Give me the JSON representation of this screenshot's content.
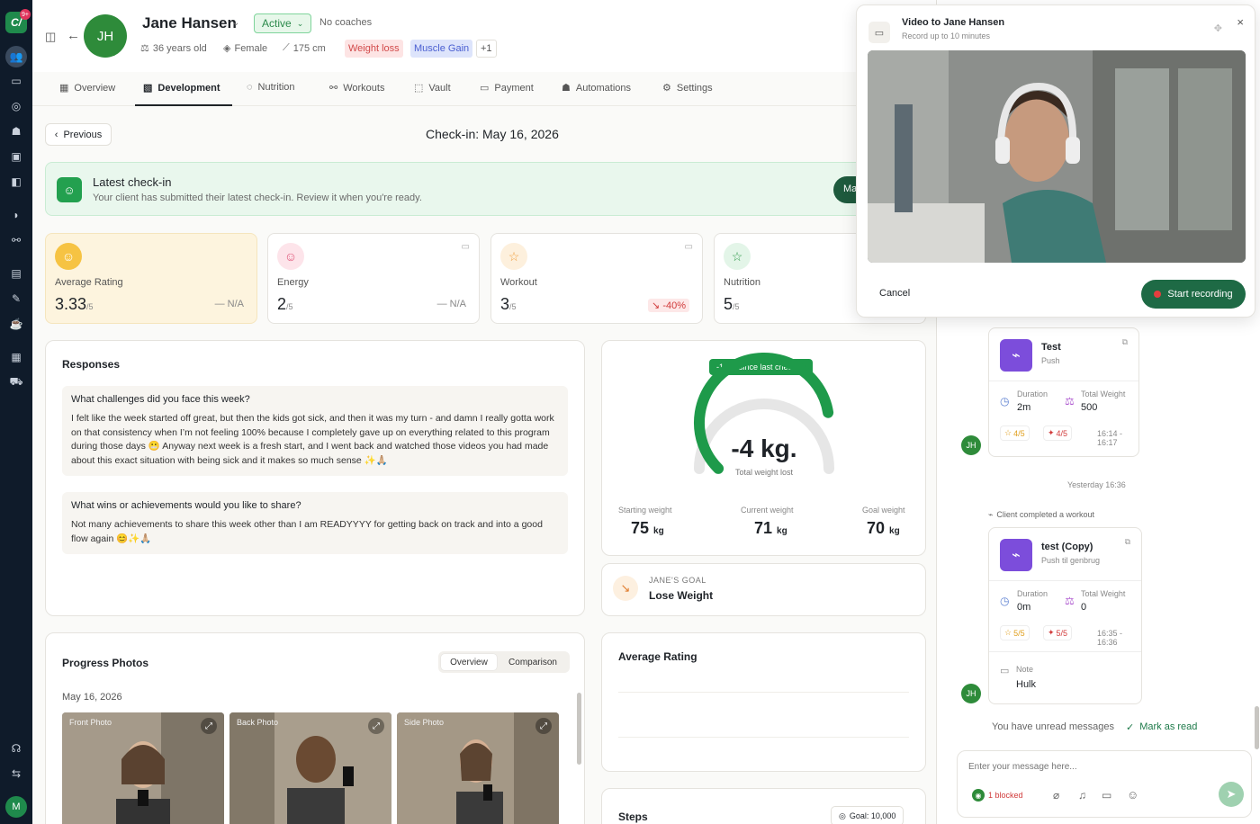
{
  "rail": {
    "badge": "9+",
    "logo_text": "C/",
    "avatar": "M",
    "icons": [
      "users-icon",
      "inbox-icon",
      "target-icon",
      "robot-icon",
      "image-icon",
      "dashboard-icon",
      "drop-icon",
      "link-icon",
      "book-icon",
      "pen-icon",
      "cup-icon",
      "document-icon",
      "truck-icon",
      "headset-icon",
      "toggle-icon"
    ]
  },
  "client": {
    "initials": "JH",
    "name": "Jane Hansen",
    "status": "Active",
    "coaches": "No coaches",
    "age": "36 years old",
    "gender": "Female",
    "height": "175 cm",
    "tags": [
      "Weight loss",
      "Muscle Gain"
    ],
    "more_tags": "+1"
  },
  "tabs": [
    "Overview",
    "Development",
    "Nutrition",
    "Workouts",
    "Vault",
    "Payment",
    "Automations",
    "Settings"
  ],
  "checkin": {
    "previous_label": "Previous",
    "title": "Check-in: May 16, 2026",
    "banner_title": "Latest check-in",
    "banner_sub": "Your client has submitted their latest check-in. Review it when you're ready.",
    "banner_button": "Ma"
  },
  "ratings": [
    {
      "label": "Average Rating",
      "value": "3.33",
      "max": "/5",
      "delta": "— N/A",
      "icon": "smile-icon",
      "color": "#f2b630"
    },
    {
      "label": "Energy",
      "value": "2",
      "max": "/5",
      "delta": "— N/A",
      "icon": "smile-icon",
      "color": "#e0577a"
    },
    {
      "label": "Workout",
      "value": "3",
      "max": "/5",
      "delta": "↘ -40%",
      "icon": "star-icon",
      "color": "#f0a040"
    },
    {
      "label": "Nutrition",
      "value": "5",
      "max": "/5",
      "delta": "",
      "icon": "star-icon",
      "color": "#2e9a4a"
    }
  ],
  "responses": {
    "title": "Responses",
    "items": [
      {
        "q": "What challenges did you face this week?",
        "a": "I felt like the week started off great, but then the kids got sick, and then it was my turn - and damn I really gotta work on that consistency when I’m not feeling 100% because I completely gave up on everything related to this program during those days 😬 Anyway next week is a fresh start, and I went back and watched those videos you had made about this exact situation with being sick and it makes so much sense ✨🙏🏼"
      },
      {
        "q": "What wins or achievements would you like to share?",
        "a": "Not many achievements to share this week other than I am READYYYY for getting back on track and into a good flow again 😊✨🙏🏼"
      }
    ]
  },
  "weight": {
    "since_last": "-1 kg. since last check-in",
    "total": "-4 kg.",
    "total_label": "Total weight lost",
    "progress": 0.8,
    "starting_label": "Starting weight",
    "starting": "75",
    "starting_unit": "kg",
    "current_label": "Current weight",
    "current": "71",
    "current_unit": "kg",
    "goal_label": "Goal weight",
    "goal": "70",
    "goal_unit": "kg"
  },
  "goal": {
    "label": "JANE'S GOAL",
    "value": "Lose Weight"
  },
  "photos": {
    "title": "Progress Photos",
    "seg": [
      "Overview",
      "Comparison"
    ],
    "date": "May 16, 2026",
    "items": [
      "Front Photo",
      "Back Photo",
      "Side Photo"
    ]
  },
  "avg_rating": {
    "title": "Average Rating"
  },
  "steps": {
    "title": "Steps",
    "goal": "Goal: 10,000"
  },
  "feed": {
    "w1": {
      "name": "Test",
      "sub": "Push",
      "duration_label": "Duration",
      "duration": "2m",
      "weight_label": "Total Weight",
      "weight": "500",
      "r1": "4/5",
      "r2": "4/5",
      "time": "16:14 - 16:17"
    },
    "yesterday": "Yesterday 16:36",
    "completed": "Client completed a workout",
    "w2": {
      "name": "test (Copy)",
      "sub": "Push til genbrug",
      "duration_label": "Duration",
      "duration": "0m",
      "weight_label": "Total Weight",
      "weight": "0",
      "r1": "5/5",
      "r2": "5/5",
      "time": "16:35 - 16:36",
      "note_label": "Note",
      "note": "Hulk"
    },
    "avatar": "JH",
    "unread": "You have unread messages",
    "mark_read": "Mark as read",
    "composer_placeholder": "Enter your message here...",
    "blocked": "1 blocked"
  },
  "modal": {
    "title": "Video to Jane Hansen",
    "sub": "Record up to 10 minutes",
    "cancel": "Cancel",
    "record": "Start recording"
  }
}
